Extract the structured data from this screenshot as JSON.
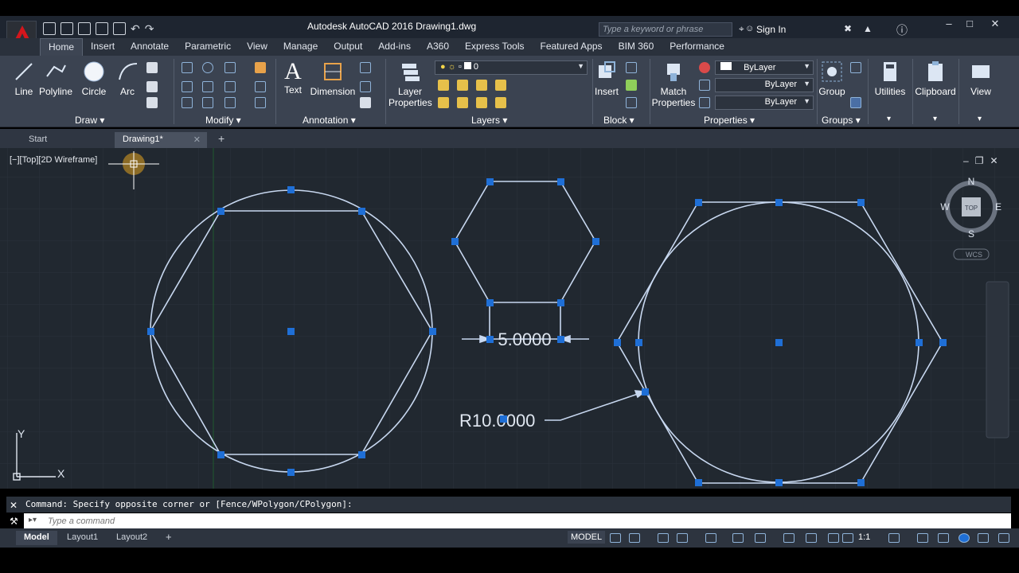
{
  "window": {
    "title": "Autodesk AutoCAD 2016    Drawing1.dwg",
    "search_placeholder": "Type a keyword or phrase",
    "sign_in": "Sign In"
  },
  "ribbon_tabs": [
    "Home",
    "Insert",
    "Annotate",
    "Parametric",
    "View",
    "Manage",
    "Output",
    "Add-ins",
    "A360",
    "Express Tools",
    "Featured Apps",
    "BIM 360",
    "Performance"
  ],
  "ribbon": {
    "draw": {
      "line": "Line",
      "polyline": "Polyline",
      "circle": "Circle",
      "arc": "Arc",
      "title": "Draw"
    },
    "modify": {
      "title": "Modify"
    },
    "annotation": {
      "text": "Text",
      "dimension": "Dimension",
      "title": "Annotation"
    },
    "layers": {
      "layer_properties_1": "Layer",
      "layer_properties_2": "Properties",
      "layer_value": "0",
      "title": "Layers"
    },
    "block": {
      "insert": "Insert",
      "title": "Block"
    },
    "properties": {
      "match_1": "Match",
      "match_2": "Properties",
      "color": "ByLayer",
      "linetype": "ByLayer",
      "lineweight": "ByLayer",
      "title": "Properties"
    },
    "groups": {
      "group": "Group",
      "title": "Groups"
    },
    "utilities": "Utilities",
    "clipboard": "Clipboard",
    "view": "View"
  },
  "file_tabs": {
    "start": "Start",
    "drawing": "Drawing1*"
  },
  "viewport": {
    "label": "[−][Top][2D Wireframe]",
    "compass": {
      "n": "N",
      "s": "S",
      "e": "E",
      "w": "W",
      "top": "TOP",
      "wcs": "WCS"
    },
    "dim_linear": "5.0000",
    "dim_radius": "R10.0000",
    "ucs_x": "X",
    "ucs_y": "Y"
  },
  "command": {
    "history": "Command: Specify opposite corner or [Fence/WPolygon/CPolygon]:",
    "placeholder": "Type a command"
  },
  "status": {
    "layouts": [
      "Model",
      "Layout1",
      "Layout2"
    ],
    "model": "MODEL",
    "scale": "1:1"
  },
  "colors": {
    "canvas": "#212830",
    "geometry": "#c8d8f0",
    "grip": "#1f6fd6",
    "ribbon": "#3b4351"
  }
}
